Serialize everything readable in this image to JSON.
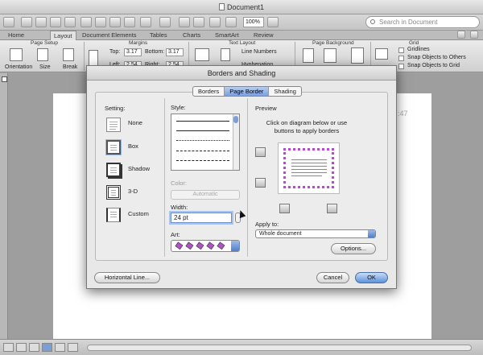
{
  "window": {
    "title": "Document1"
  },
  "toolbar": {
    "zoom": "100%",
    "search_placeholder": "Search in Document"
  },
  "ribbon_tabs": [
    "Home",
    "Layout",
    "Document Elements",
    "Tables",
    "Charts",
    "SmartArt",
    "Review"
  ],
  "ribbon": {
    "groups": {
      "page_setup": "Page Setup",
      "margins": "Margins",
      "text_layout": "Text Layout",
      "page_background": "Page Background",
      "grid": "Grid"
    },
    "buttons": {
      "orientation": "Orientation",
      "size": "Size",
      "break": "Break",
      "line_numbers": "Line Numbers",
      "hyphenation": "Hyphenation"
    },
    "margins": {
      "top_label": "Top:",
      "top_value": "3.17",
      "bottom_label": "Bottom:",
      "bottom_value": "3.17",
      "left_label": "Left:",
      "left_value": "2.54",
      "right_label": "Right:",
      "right_value": "2.54"
    },
    "grid": {
      "gridlines": "Gridlines",
      "snap_objects": "Snap Objects to Others",
      "snap_grid": "Snap Objects to Grid"
    }
  },
  "document": {
    "time_fragment": ":47"
  },
  "dialog": {
    "title": "Borders and Shading",
    "tabs": [
      "Borders",
      "Page Border",
      "Shading"
    ],
    "active_tab": "Page Border",
    "setting_label": "Setting:",
    "settings": [
      "None",
      "Box",
      "Shadow",
      "3-D",
      "Custom"
    ],
    "selected_setting": "Box",
    "style_label": "Style:",
    "color_label": "Color:",
    "color_value": "Automatic",
    "width_label": "Width:",
    "width_value": "24 pt",
    "art_label": "Art:",
    "preview_label": "Preview",
    "preview_instructions": "Click on diagram below or use buttons to apply borders",
    "apply_to_label": "Apply to:",
    "apply_to_value": "Whole document",
    "options_button": "Options...",
    "horizontal_line_button": "Horizontal Line...",
    "cancel_button": "Cancel",
    "ok_button": "OK"
  },
  "colors": {
    "accent": "#5e92dc",
    "art_border": "#b04fc6"
  }
}
